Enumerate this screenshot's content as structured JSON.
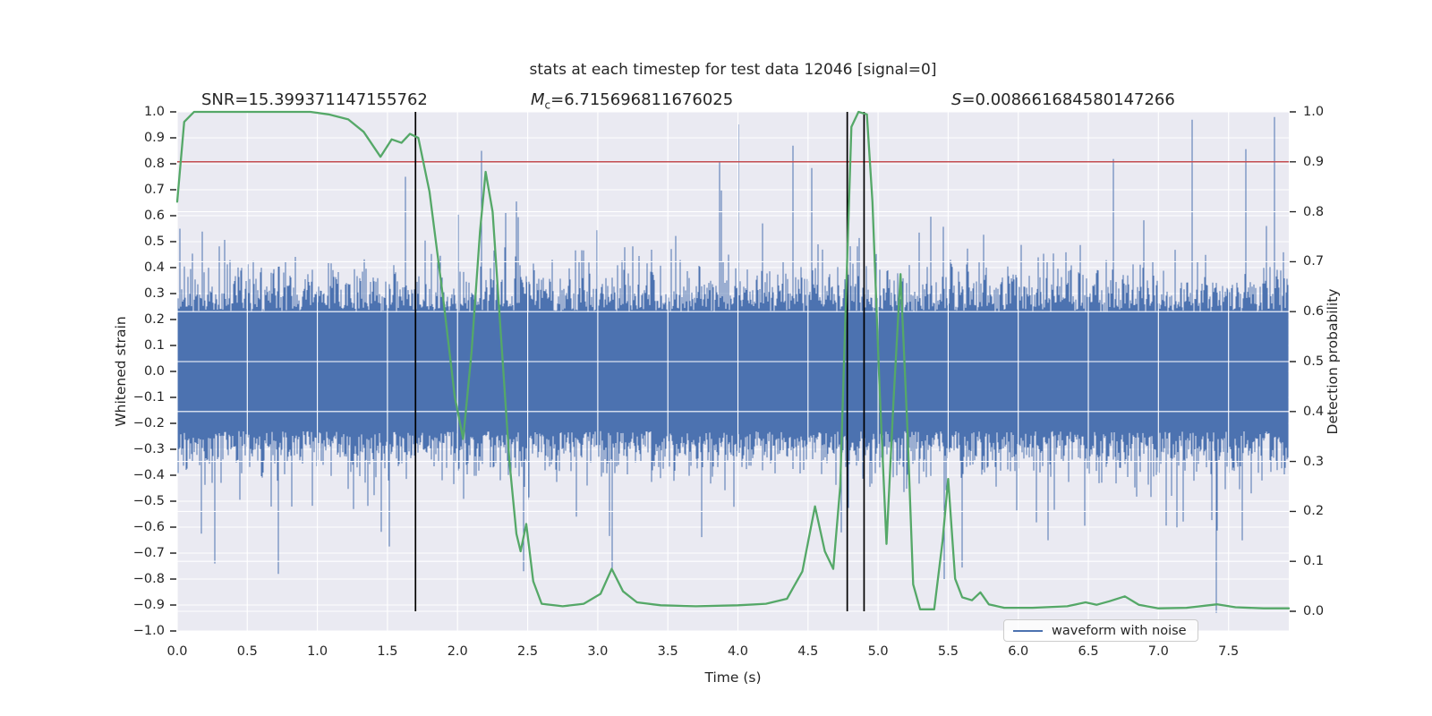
{
  "title": "stats at each timestep for test data 12046 [signal=0]",
  "annotations": {
    "snr": "SNR=15.399371147155762",
    "mc_var": "M",
    "mc_sub": "c",
    "mc_value": "=6.715696811676025",
    "s_var": "S",
    "s_value": "=0.008661684580147266"
  },
  "axes": {
    "x": {
      "label": "Time (s)",
      "tick_labels": [
        "0.0",
        "0.5",
        "1.0",
        "1.5",
        "2.0",
        "2.5",
        "3.0",
        "3.5",
        "4.0",
        "4.5",
        "5.0",
        "5.5",
        "6.0",
        "6.5",
        "7.0",
        "7.5"
      ],
      "tick_values": [
        0,
        0.5,
        1,
        1.5,
        2,
        2.5,
        3,
        3.5,
        4,
        4.5,
        5,
        5.5,
        6,
        6.5,
        7,
        7.5
      ]
    },
    "y_left": {
      "label": "Whitened strain",
      "tick_labels": [
        "1.0",
        "0.9",
        "0.8",
        "0.7",
        "0.6",
        "0.5",
        "0.4",
        "0.3",
        "0.2",
        "0.1",
        "0.0",
        "−0.1",
        "−0.2",
        "−0.3",
        "−0.4",
        "−0.5",
        "−0.6",
        "−0.7",
        "−0.8",
        "−0.9",
        "−1.0"
      ],
      "tick_values": [
        1.0,
        0.9,
        0.8,
        0.7,
        0.6,
        0.5,
        0.4,
        0.3,
        0.2,
        0.1,
        0.0,
        -0.1,
        -0.2,
        -0.3,
        -0.4,
        -0.5,
        -0.6,
        -0.7,
        -0.8,
        -0.9,
        -1.0
      ]
    },
    "y_right": {
      "label": "Detection probability",
      "tick_labels": [
        "1.0",
        "0.9",
        "0.8",
        "0.7",
        "0.6",
        "0.5",
        "0.4",
        "0.3",
        "0.2",
        "0.1",
        "0.0"
      ],
      "tick_values": [
        1.0,
        0.9,
        0.8,
        0.7,
        0.6,
        0.5,
        0.4,
        0.3,
        0.2,
        0.1,
        0.0
      ]
    }
  },
  "legend": {
    "items": [
      {
        "label": "waveform with noise",
        "color": "#4C72B0"
      }
    ]
  },
  "colors": {
    "axes_background": "#EAEAF2",
    "grid": "#FFFFFF",
    "waveform": "#4C72B0",
    "detection_probability": "#55A868",
    "threshold": "#C44E52",
    "event_marker": "#000000",
    "text": "#262626"
  },
  "chart_data": {
    "type": "line",
    "title": "stats at each timestep for test data 12046 [signal=0]",
    "xlabel": "Time (s)",
    "ylabel_left": "Whitened strain",
    "ylabel_right": "Detection probability",
    "xlim": [
      0,
      7.93
    ],
    "ylim_left": [
      -1.0,
      1.0
    ],
    "ylim_right": [
      -0.04,
      1.0
    ],
    "grid": true,
    "legend_position": "lower right",
    "stats": {
      "SNR": 15.399371147155762,
      "Mc": 6.715696811676025,
      "S": 0.008661684580147266
    },
    "threshold_line": {
      "axis": "right",
      "value": 0.9,
      "color": "#C44E52"
    },
    "event_vlines": {
      "x_values": [
        1.7,
        4.78,
        4.9
      ],
      "color": "#000000",
      "span_right_axis": [
        0.0,
        1.0
      ]
    },
    "series": [
      {
        "name": "waveform with noise",
        "axis": "left",
        "style": "dense noise envelope, zero-mean; solid band about ±0.26, frequent excursions to ±0.55, sparse spikes to ±0.95",
        "generator": {
          "seed": 12046,
          "columns": 1242,
          "base": 0.23,
          "sigma": 0.088,
          "tail_prob": 0.05,
          "tail_base": 0.1,
          "tail_scale": 0.45,
          "clamp": 0.96
        },
        "notable_spikes": [
          {
            "t": 7.83,
            "v": 0.98
          },
          {
            "t": 7.24,
            "v": 0.97
          },
          {
            "t": 2.17,
            "v": 0.85
          },
          {
            "t": 4.39,
            "v": 0.87
          },
          {
            "t": 3.87,
            "v": 0.81
          },
          {
            "t": 7.41,
            "v": -0.93
          },
          {
            "t": 5.47,
            "v": -0.8
          },
          {
            "t": 0.72,
            "v": -0.78
          },
          {
            "t": 2.47,
            "v": -0.77
          },
          {
            "t": 0.27,
            "v": -0.74
          }
        ]
      },
      {
        "name": "detection probability",
        "axis": "right",
        "points": [
          [
            0.0,
            0.82
          ],
          [
            0.05,
            0.98
          ],
          [
            0.12,
            1.0
          ],
          [
            0.5,
            1.0
          ],
          [
            0.95,
            1.0
          ],
          [
            1.08,
            0.995
          ],
          [
            1.22,
            0.985
          ],
          [
            1.33,
            0.96
          ],
          [
            1.45,
            0.91
          ],
          [
            1.53,
            0.945
          ],
          [
            1.6,
            0.938
          ],
          [
            1.66,
            0.956
          ],
          [
            1.72,
            0.948
          ],
          [
            1.8,
            0.84
          ],
          [
            1.9,
            0.62
          ],
          [
            1.98,
            0.43
          ],
          [
            2.04,
            0.345
          ],
          [
            2.1,
            0.52
          ],
          [
            2.16,
            0.76
          ],
          [
            2.2,
            0.88
          ],
          [
            2.25,
            0.8
          ],
          [
            2.31,
            0.55
          ],
          [
            2.37,
            0.3
          ],
          [
            2.42,
            0.155
          ],
          [
            2.45,
            0.12
          ],
          [
            2.49,
            0.175
          ],
          [
            2.54,
            0.06
          ],
          [
            2.6,
            0.015
          ],
          [
            2.75,
            0.01
          ],
          [
            2.9,
            0.015
          ],
          [
            3.02,
            0.035
          ],
          [
            3.1,
            0.085
          ],
          [
            3.18,
            0.04
          ],
          [
            3.28,
            0.018
          ],
          [
            3.45,
            0.012
          ],
          [
            3.7,
            0.01
          ],
          [
            4.0,
            0.012
          ],
          [
            4.2,
            0.015
          ],
          [
            4.35,
            0.025
          ],
          [
            4.46,
            0.08
          ],
          [
            4.55,
            0.21
          ],
          [
            4.62,
            0.12
          ],
          [
            4.68,
            0.085
          ],
          [
            4.73,
            0.25
          ],
          [
            4.77,
            0.62
          ],
          [
            4.81,
            0.97
          ],
          [
            4.86,
            1.0
          ],
          [
            4.92,
            0.995
          ],
          [
            4.96,
            0.82
          ],
          [
            5.01,
            0.45
          ],
          [
            5.06,
            0.135
          ],
          [
            5.11,
            0.42
          ],
          [
            5.16,
            0.675
          ],
          [
            5.21,
            0.36
          ],
          [
            5.25,
            0.054
          ],
          [
            5.3,
            0.004
          ],
          [
            5.4,
            0.004
          ],
          [
            5.46,
            0.14
          ],
          [
            5.5,
            0.265
          ],
          [
            5.55,
            0.065
          ],
          [
            5.6,
            0.028
          ],
          [
            5.67,
            0.022
          ],
          [
            5.73,
            0.038
          ],
          [
            5.79,
            0.014
          ],
          [
            5.9,
            0.007
          ],
          [
            6.1,
            0.007
          ],
          [
            6.35,
            0.01
          ],
          [
            6.48,
            0.018
          ],
          [
            6.56,
            0.013
          ],
          [
            6.65,
            0.02
          ],
          [
            6.76,
            0.03
          ],
          [
            6.86,
            0.013
          ],
          [
            7.0,
            0.006
          ],
          [
            7.2,
            0.007
          ],
          [
            7.42,
            0.014
          ],
          [
            7.55,
            0.008
          ],
          [
            7.75,
            0.006
          ],
          [
            7.93,
            0.006
          ]
        ]
      }
    ]
  }
}
